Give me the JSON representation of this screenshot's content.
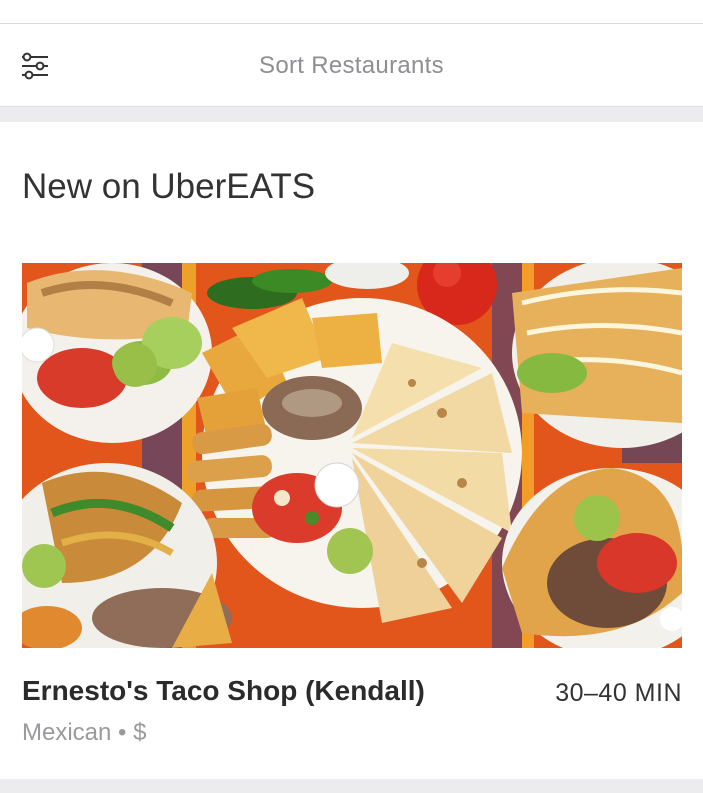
{
  "header": {
    "sort_label": "Sort Restaurants"
  },
  "section": {
    "title": "New on UberEATS"
  },
  "restaurant": {
    "name": "Ernesto's Taco Shop (Kendall)",
    "eta": "30–40 MIN",
    "cuisine": "Mexican",
    "separator": "•",
    "price": "$"
  },
  "colors": {
    "title_text": "#333333",
    "muted_text": "#8e8e93",
    "band": "#ececee"
  },
  "icons": {
    "sort": "sliders-icon",
    "hero": "food-platter-image"
  }
}
